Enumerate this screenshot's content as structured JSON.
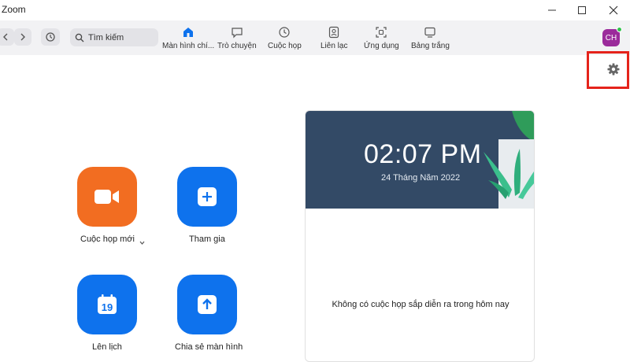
{
  "window": {
    "title": "Zoom"
  },
  "search": {
    "label": "Tìm kiếm"
  },
  "tabs": [
    {
      "label": "Màn hình chí..."
    },
    {
      "label": "Trò chuyện"
    },
    {
      "label": "Cuộc họp"
    },
    {
      "label": "Liên lạc"
    },
    {
      "label": "Ứng dụng"
    },
    {
      "label": "Bảng trắng"
    }
  ],
  "user": {
    "initials": "CH",
    "status_color": "#33c24d"
  },
  "actions": {
    "new_meeting": "Cuộc họp mới",
    "join": "Tham gia",
    "schedule": "Lên lịch",
    "schedule_day": "19",
    "share_screen": "Chia sẻ màn hình"
  },
  "card": {
    "time": "02:07 PM",
    "date": "24 Tháng Năm 2022",
    "empty_message": "Không có cuộc họp sắp diễn ra trong hôm nay"
  },
  "colors": {
    "accent": "#0e72ed",
    "orange": "#f26d21",
    "highlight": "#e5231b",
    "card_header": "#334a66"
  }
}
